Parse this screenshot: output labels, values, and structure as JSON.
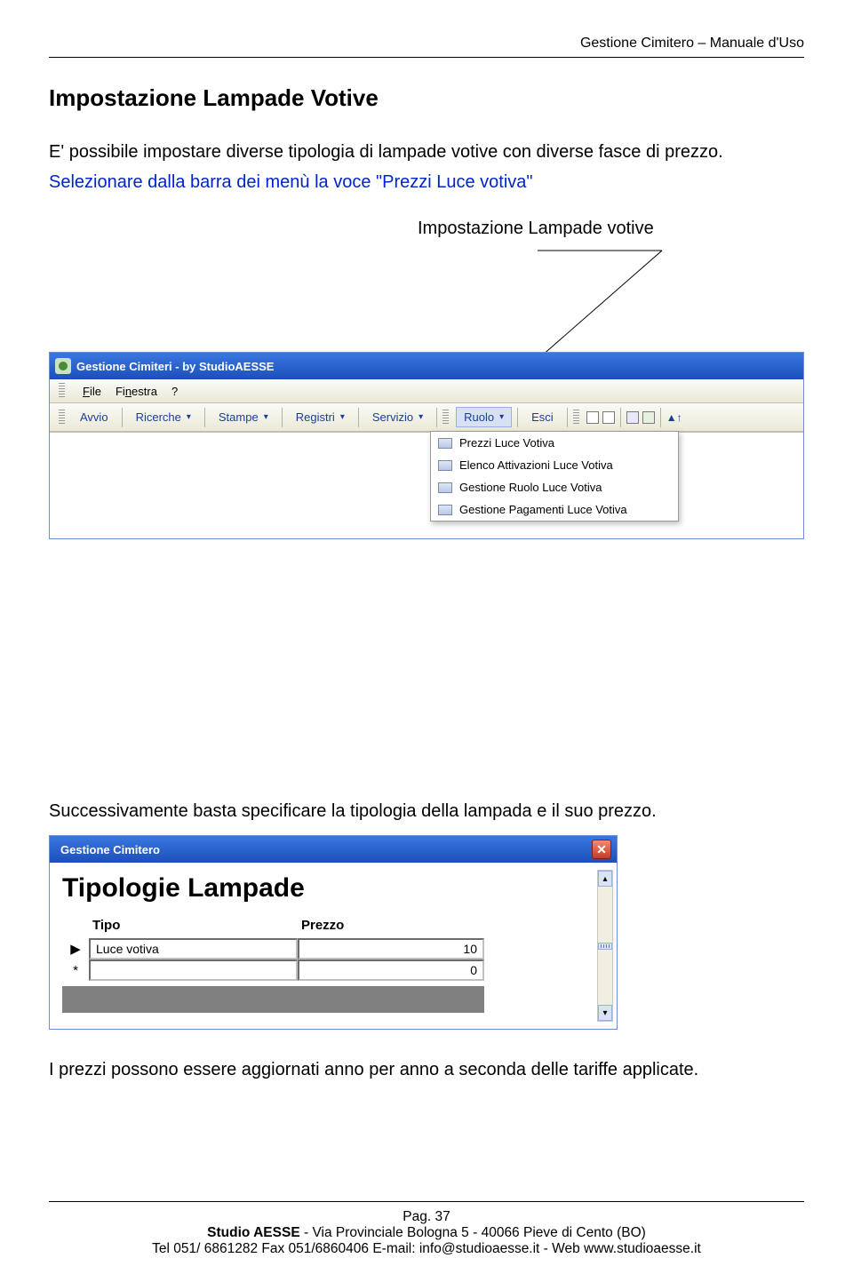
{
  "header": {
    "title": "Gestione Cimitero – Manuale d'Uso"
  },
  "section": {
    "heading": "Impostazione Lampade Votive",
    "intro": "E' possibile impostare diverse tipologia di lampade votive con diverse fasce di prezzo.",
    "instruction": "Selezionare dalla barra dei menù la voce \"Prezzi Luce votiva\"",
    "callout": "Impostazione Lampade votive",
    "after1": "Successivamente basta specificare la tipologia della lampada e il suo prezzo.",
    "after2": "I prezzi possono essere aggiornati anno per anno a seconda delle tariffe applicate."
  },
  "app": {
    "title": "Gestione Cimiteri - by StudioAESSE",
    "menus": {
      "file": "File",
      "finestra": "Finestra",
      "help": "?"
    },
    "toolbar": {
      "avvio": "Avvio",
      "ricerche": "Ricerche",
      "stampe": "Stampe",
      "registri": "Registri",
      "servizio": "Servizio",
      "ruolo": "Ruolo",
      "esci": "Esci"
    },
    "ruolo_menu": [
      "Prezzi Luce Votiva",
      "Elenco Attivazioni Luce Votiva",
      "Gestione Ruolo Luce Votiva",
      "Gestione Pagamenti Luce Votiva"
    ]
  },
  "dialog": {
    "title": "Gestione Cimitero",
    "big_title": "Tipologie Lampade",
    "cols": {
      "tipo": "Tipo",
      "prezzo": "Prezzo"
    },
    "rows": [
      {
        "marker": "▶",
        "tipo": "Luce votiva",
        "prezzo": "10"
      },
      {
        "marker": "*",
        "tipo": "",
        "prezzo": "0"
      }
    ]
  },
  "footer": {
    "page": "Pag. 37",
    "line1_bold": "Studio AESSE",
    "line1_rest": " - Via Provinciale Bologna 5 - 40066 Pieve di Cento (BO)",
    "line2": "Tel 051/ 6861282  Fax 051/6860406 E-mail: info@studioaesse.it -  Web www.studioaesse.it"
  }
}
